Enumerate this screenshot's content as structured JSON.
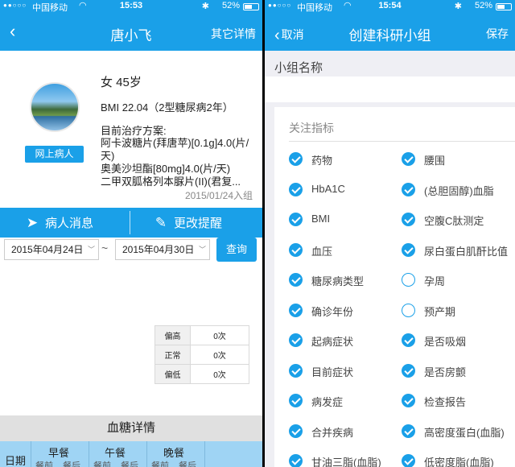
{
  "left": {
    "status": {
      "carrier": "中国移动",
      "time": "15:53",
      "battery": "52%"
    },
    "nav": {
      "back_icon": "chevron-left-icon",
      "title": "唐小飞",
      "right": "其它详情"
    },
    "patient": {
      "gender_age": "女 45岁",
      "bmi": "BMI 22.04（2型糖尿病2年）",
      "badge": "网上病人",
      "plan_title": "目前治疗方案:",
      "drug1": "阿卡波糖片(拜唐苹)[0.1g]4.0(片/天)",
      "drug2": "奥美沙坦酯[80mg]4.0(片/天)",
      "drug3": "二甲双胍格列本脲片(II)(君复...",
      "join_date": "2015/01/24入组"
    },
    "actions": {
      "messages": "病人消息",
      "reminder": "更改提醒"
    },
    "filter": {
      "start": "2015年04月24日",
      "end": "2015年04月30日",
      "query": "查询"
    },
    "stats": [
      {
        "label": "偏高",
        "value": "0次"
      },
      {
        "label": "正常",
        "value": "0次"
      },
      {
        "label": "偏低",
        "value": "0次"
      }
    ],
    "detail_title": "血糖详情",
    "table": {
      "date": "日期",
      "breakfast": "早餐",
      "lunch": "午餐",
      "dinner": "晚餐",
      "sub": [
        "餐前",
        "餐后",
        "餐前",
        "餐后",
        "餐前",
        "餐后"
      ]
    }
  },
  "right": {
    "status": {
      "carrier": "中国移动",
      "time": "15:54",
      "battery": "52%"
    },
    "nav": {
      "cancel": "取消",
      "title": "创建科研小组",
      "save": "保存"
    },
    "name_label": "小组名称",
    "indicators_title": "关注指标",
    "indicators": [
      {
        "label": "药物",
        "checked": true
      },
      {
        "label": "腰围",
        "checked": true
      },
      {
        "label": "HbA1C",
        "checked": true
      },
      {
        "label": "(总胆固醇)血脂",
        "checked": true
      },
      {
        "label": "BMI",
        "checked": true
      },
      {
        "label": "空腹C肽测定",
        "checked": true
      },
      {
        "label": "血压",
        "checked": true
      },
      {
        "label": "尿白蛋白肌酐比值",
        "checked": true
      },
      {
        "label": "糖尿病类型",
        "checked": true
      },
      {
        "label": "孕周",
        "checked": false
      },
      {
        "label": "确诊年份",
        "checked": true
      },
      {
        "label": "预产期",
        "checked": false
      },
      {
        "label": "起病症状",
        "checked": true
      },
      {
        "label": "是否吸烟",
        "checked": true
      },
      {
        "label": "目前症状",
        "checked": true
      },
      {
        "label": "是否房颤",
        "checked": true
      },
      {
        "label": "病发症",
        "checked": true
      },
      {
        "label": "检查报告",
        "checked": true
      },
      {
        "label": "合并疾病",
        "checked": true
      },
      {
        "label": "高密度蛋白(血脂)",
        "checked": true
      },
      {
        "label": "甘油三脂(血脂)",
        "checked": true
      },
      {
        "label": "低密度脂(血脂)",
        "checked": true
      }
    ]
  }
}
